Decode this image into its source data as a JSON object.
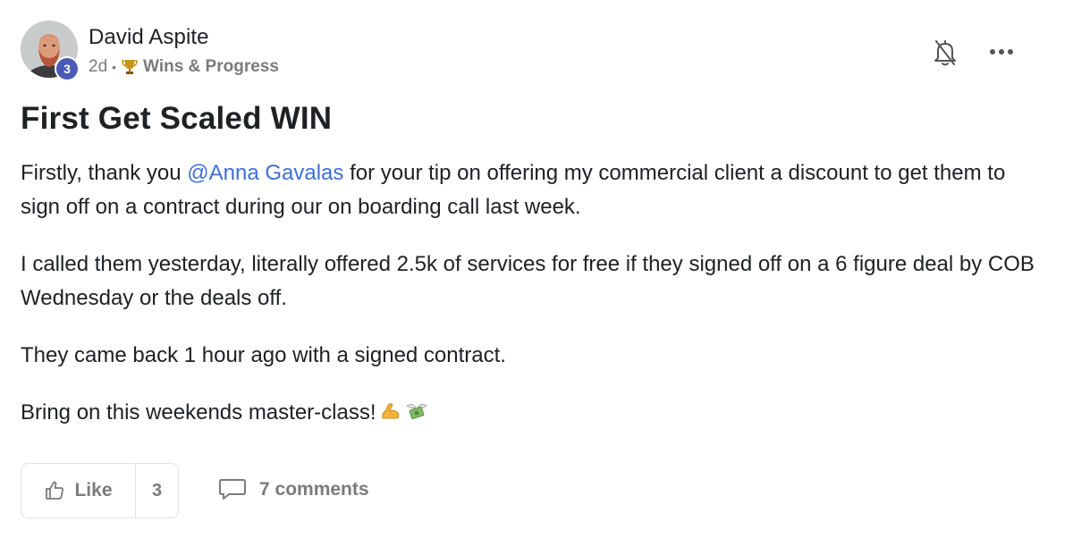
{
  "author": {
    "name": "David Aspite",
    "level": "3",
    "avatar_icon": "user-avatar-photo"
  },
  "meta": {
    "time": "2d",
    "separator": "•",
    "category_icon": "trophy-icon",
    "category": "Wins & Progress"
  },
  "actions": {
    "notification_icon": "bell-off-icon",
    "more_icon": "more-horizontal-icon"
  },
  "post": {
    "title": "First Get Scaled WIN",
    "paragraphs": {
      "p1_before": "Firstly, thank you ",
      "p1_mention": "@Anna Gavalas",
      "p1_after": " for your tip on offering my commercial client a discount to get them to sign off on a contract during our on boarding call last week.",
      "p2": "I called them yesterday, literally offered 2.5k of services for free if they signed off on a 6 figure deal by COB Wednesday or the deals off.",
      "p3": "They came back 1 hour ago with a signed contract.",
      "p4": "Bring on this weekends master-class!"
    },
    "emojis": [
      "flexed-biceps-icon",
      "money-with-wings-icon"
    ]
  },
  "footer": {
    "like_label": "Like",
    "like_icon": "thumbs-up-icon",
    "like_count": "3",
    "comments_icon": "comment-bubble-icon",
    "comments_label": "7 comments"
  },
  "colors": {
    "mention": "#3e6fd6",
    "badge": "#4a5bb5",
    "muted": "#7b7b7b",
    "text": "#202124"
  }
}
